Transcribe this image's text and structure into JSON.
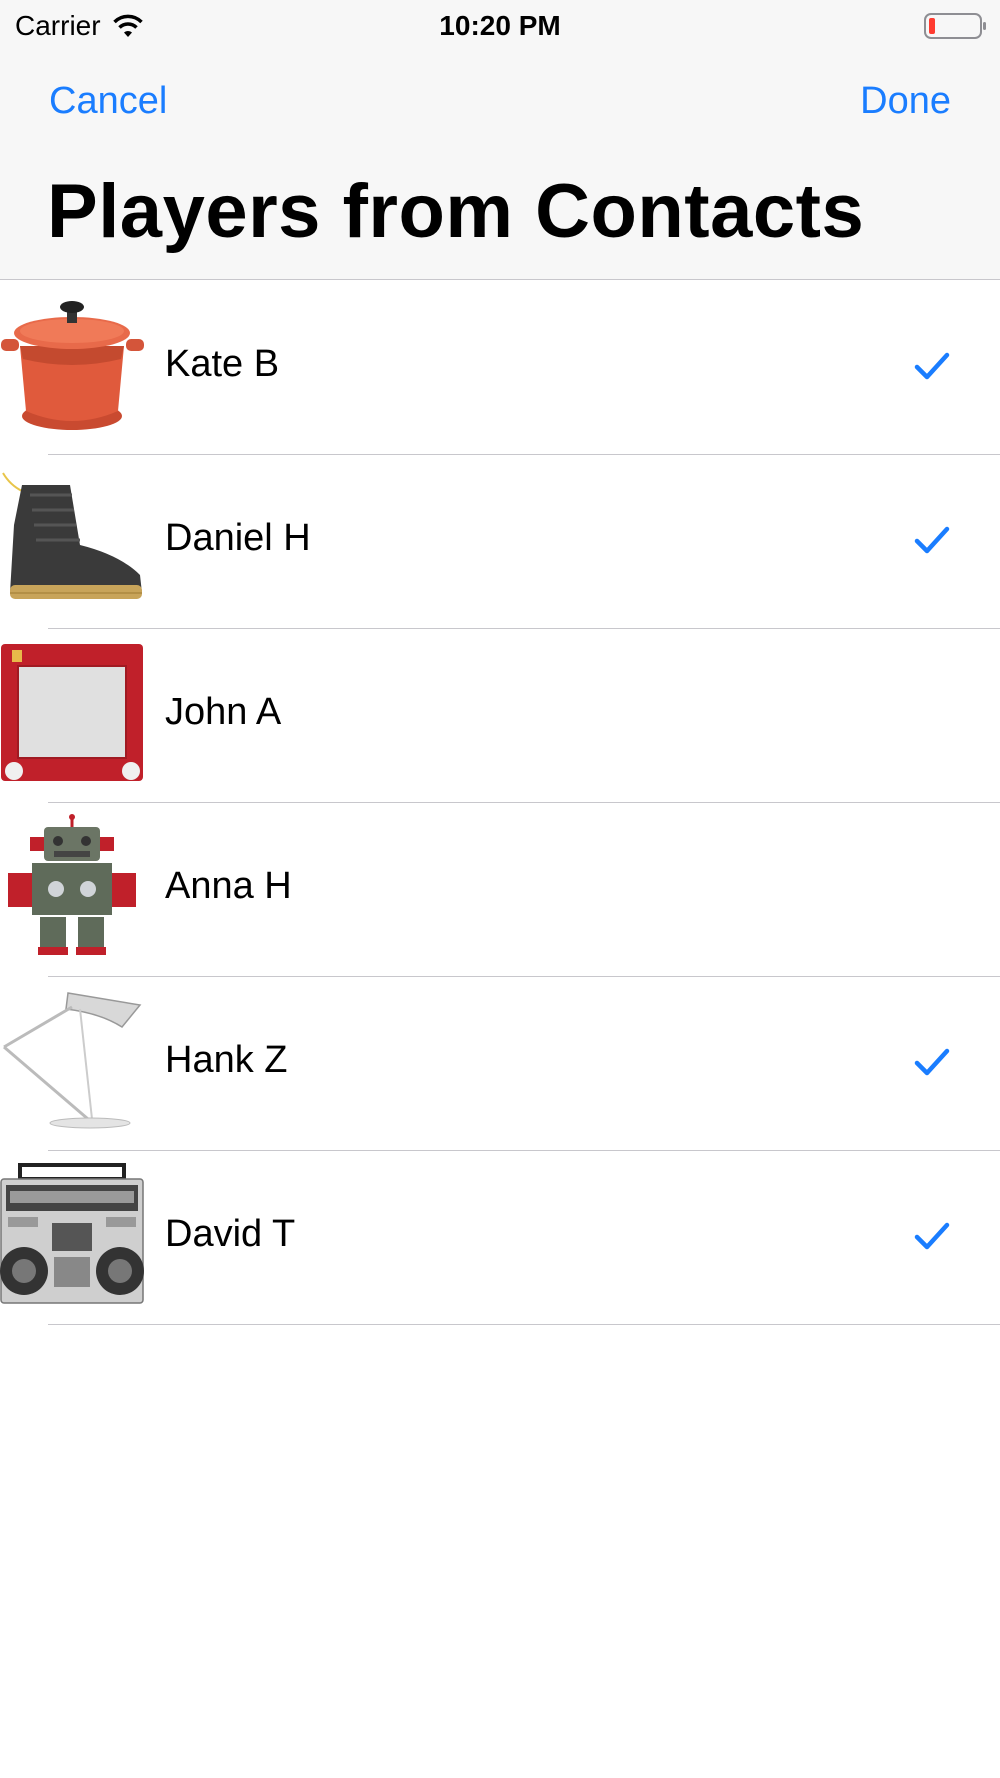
{
  "status_bar": {
    "carrier": "Carrier",
    "time": "10:20 PM",
    "wifi_icon": "wifi-icon",
    "battery_icon": "battery-low-icon"
  },
  "nav": {
    "cancel_label": "Cancel",
    "done_label": "Done",
    "title": "Players from Contacts"
  },
  "colors": {
    "accent": "#1a7dff",
    "battery_low": "#ff3b30",
    "separator": "#c8c7cc",
    "header_bg": "#f7f7f7"
  },
  "players": [
    {
      "name": "Kate B",
      "selected": true,
      "avatar": "cooking-pot-icon"
    },
    {
      "name": "Daniel H",
      "selected": true,
      "avatar": "boot-icon"
    },
    {
      "name": "John A",
      "selected": false,
      "avatar": "etch-a-sketch-icon"
    },
    {
      "name": "Anna H",
      "selected": false,
      "avatar": "robot-icon"
    },
    {
      "name": "Hank Z",
      "selected": true,
      "avatar": "desk-lamp-icon"
    },
    {
      "name": "David T",
      "selected": true,
      "avatar": "boombox-icon"
    }
  ]
}
